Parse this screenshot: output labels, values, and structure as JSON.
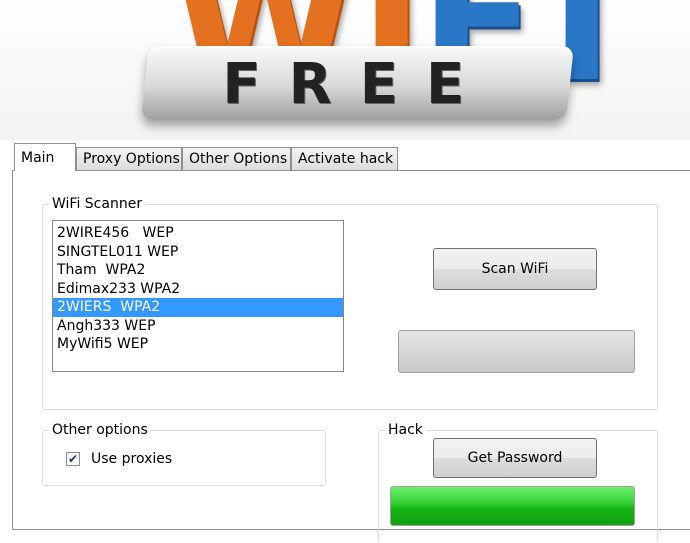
{
  "banner": {
    "logo_top_letters": "WiFi",
    "logo_bottom_text": "FREE",
    "colors": {
      "orange": "#e4711f",
      "blue": "#2a77c7"
    }
  },
  "tabs": [
    {
      "label": "Main",
      "active": true
    },
    {
      "label": "Proxy Options",
      "active": false
    },
    {
      "label": "Other Options",
      "active": false
    },
    {
      "label": "Activate hack",
      "active": false
    }
  ],
  "scanner": {
    "legend": "WiFi Scanner",
    "networks": [
      "2WIRE456   WEP",
      "SINGTEL011 WEP",
      "Tham  WPA2",
      "Edimax233 WPA2",
      "2WIERS  WPA2",
      "Angh333 WEP",
      "MyWifi5 WEP"
    ],
    "selected_index": 4,
    "scan_button": "Scan WiFi",
    "scan_progress": 0
  },
  "other_options": {
    "legend": "Other options",
    "use_proxies_label": "Use proxies",
    "use_proxies_checked": true
  },
  "hack": {
    "legend": "Hack",
    "get_password_button": "Get Password",
    "progress": 1.0,
    "progress_color": "#2fcf2f"
  },
  "selection_color": "#3399ff"
}
